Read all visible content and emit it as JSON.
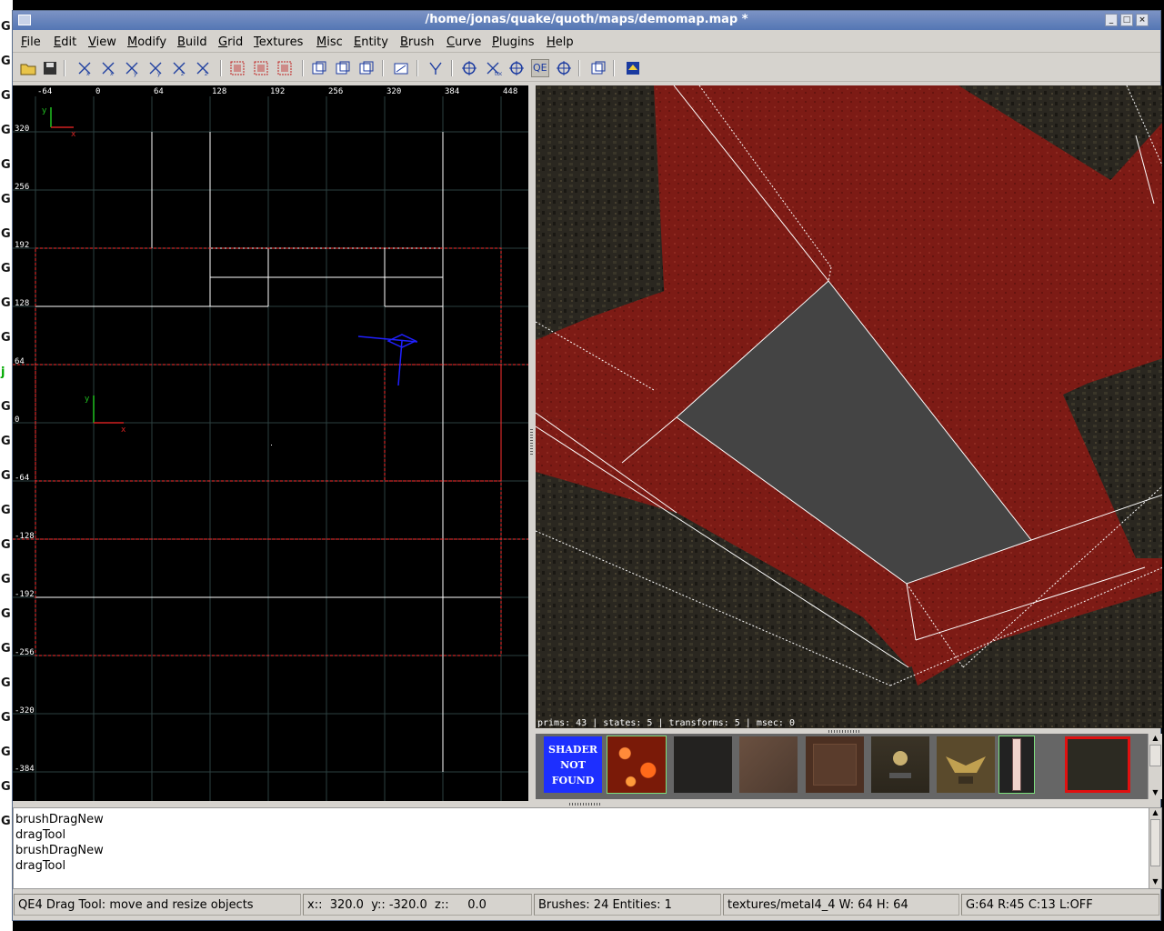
{
  "window": {
    "title": "/home/jonas/quake/quoth/maps/demomap.map *"
  },
  "desktop": {
    "letters": [
      "G",
      "G",
      "G",
      "G",
      "G",
      "G",
      "G",
      "G",
      "G",
      "G",
      "j",
      "G",
      "G",
      "G",
      "G",
      "G",
      "G",
      "G",
      "G",
      "G",
      "G",
      "G",
      "G",
      "G"
    ]
  },
  "menubar": [
    {
      "label": "File",
      "u": "F",
      "rest": "ile"
    },
    {
      "label": "Edit",
      "u": "E",
      "rest": "dit"
    },
    {
      "label": "View",
      "u": "V",
      "rest": "iew"
    },
    {
      "label": "Modify",
      "u": "M",
      "rest": "odify"
    },
    {
      "label": "Build",
      "u": "B",
      "rest": "uild"
    },
    {
      "label": "Grid",
      "u": "G",
      "rest": "rid"
    },
    {
      "label": "Textures",
      "u": "T",
      "rest": "extures"
    },
    {
      "label": "Misc",
      "u": "M",
      "rest": "isc"
    },
    {
      "label": "Entity",
      "u": "E",
      "rest": "ntity"
    },
    {
      "label": "Brush",
      "u": "B",
      "rest": "rush"
    },
    {
      "label": "Curve",
      "u": "C",
      "rest": "urve"
    },
    {
      "label": "Plugins",
      "u": "P",
      "rest": "lugins"
    },
    {
      "label": "Help",
      "u": "H",
      "rest": "elp"
    }
  ],
  "toolbar": {
    "icons": [
      "open-icon",
      "save-icon",
      "flip-x-icon",
      "rotate-x-icon",
      "flip-y-icon",
      "rotate-y-icon",
      "flip-z-icon",
      "rotate-z-icon",
      "select-complete-tall-icon",
      "select-touching-icon",
      "select-partial-tall-icon",
      "csg-subtract-icon",
      "csg-merge-icon",
      "make-hollow-icon",
      "change-views-icon",
      "texture-lock-icon",
      "move-tool-icon",
      "rotate-tool-icon",
      "scale-tool-icon",
      "qe-drag-tool-icon",
      "patch-tool-icon",
      "csg-tool-icon",
      "show-entities-icon"
    ],
    "qe_label": "QE"
  },
  "xyview": {
    "x_ticks": [
      "-64",
      "0",
      "64",
      "128",
      "192",
      "256",
      "320",
      "384",
      "448"
    ],
    "y_ticks": [
      "320",
      "256",
      "192",
      "128",
      "64",
      "0",
      "-64",
      "-128",
      "-192",
      "-256",
      "-320",
      "-384"
    ],
    "axis_x": "x",
    "axis_y": "y"
  },
  "camera": {
    "stats": "prims: 43 | states: 5 | transforms: 5 | msec: 0"
  },
  "textures": {
    "shader_not_found": [
      "SHADER",
      "NOT",
      "FOUND"
    ],
    "items": [
      "shader-not-found",
      "lava-texture",
      "dark-rock-texture",
      "rust-metal-texture",
      "brown-panel-texture",
      "skull-plaque-texture",
      "eagle-plaque-texture",
      "light-strip-texture",
      "stone-floor-texture"
    ]
  },
  "console": {
    "lines": [
      "brushDragNew",
      "dragTool",
      "brushDragNew",
      "dragTool"
    ]
  },
  "status": {
    "tool": "QE4 Drag Tool: move and resize objects",
    "coords": "x::  320.0  y:: -320.0  z::     0.0",
    "counts": "Brushes: 24 Entities: 1",
    "texture": "textures/metal4_4 W: 64 H: 64",
    "grid": "G:64  R:45  C:13  L:OFF"
  },
  "colors": {
    "titlebar": "#5476b4",
    "chrome": "#d6d3ce",
    "selection_red": "#ff3030",
    "brush_red": "#7a1a14"
  }
}
